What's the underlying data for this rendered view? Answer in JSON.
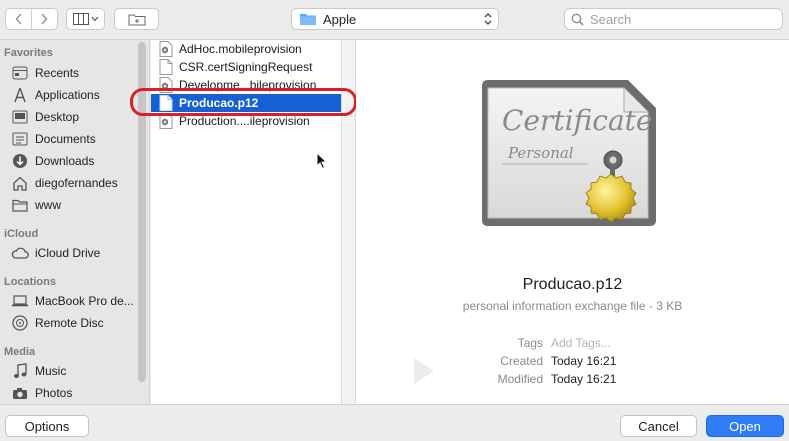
{
  "toolbar": {
    "path": "Apple",
    "search_placeholder": "Search"
  },
  "sidebar": {
    "favorites_header": "Favorites",
    "favorites": [
      {
        "label": "Recents",
        "icon": "recents-icon"
      },
      {
        "label": "Applications",
        "icon": "applications-icon"
      },
      {
        "label": "Desktop",
        "icon": "desktop-icon"
      },
      {
        "label": "Documents",
        "icon": "documents-icon"
      },
      {
        "label": "Downloads",
        "icon": "downloads-icon"
      },
      {
        "label": "diegofernandes",
        "icon": "home-icon"
      },
      {
        "label": "www",
        "icon": "folder-icon"
      }
    ],
    "icloud_header": "iCloud",
    "icloud": [
      {
        "label": "iCloud Drive",
        "icon": "icloud-icon"
      }
    ],
    "locations_header": "Locations",
    "locations": [
      {
        "label": "MacBook Pro de...",
        "icon": "laptop-icon"
      },
      {
        "label": "Remote Disc",
        "icon": "disc-icon"
      }
    ],
    "media_header": "Media",
    "media": [
      {
        "label": "Music",
        "icon": "music-icon"
      },
      {
        "label": "Photos",
        "icon": "camera-icon"
      }
    ]
  },
  "files": [
    {
      "name": "AdHoc.mobileprovision",
      "selected": false
    },
    {
      "name": "CSR.certSigningRequest",
      "selected": false
    },
    {
      "name": "Developme...bileprovision",
      "selected": false
    },
    {
      "name": "Producao.p12",
      "selected": true
    },
    {
      "name": "Production....ileprovision",
      "selected": false
    }
  ],
  "preview": {
    "name": "Producao.p12",
    "kind": "personal information exchange file - 3 KB",
    "tags_label": "Tags",
    "tags_placeholder": "Add Tags...",
    "created_label": "Created",
    "created_value": "Today 16:21",
    "modified_label": "Modified",
    "modified_value": "Today 16:21",
    "cert_title": "Certificate",
    "cert_subtitle": "Personal"
  },
  "buttons": {
    "options": "Options",
    "cancel": "Cancel",
    "open": "Open"
  },
  "colors": {
    "selection": "#1660d6",
    "accent": "#2f7df6",
    "annotation_ring": "#d8202a",
    "folder": "#5aa9f5"
  }
}
